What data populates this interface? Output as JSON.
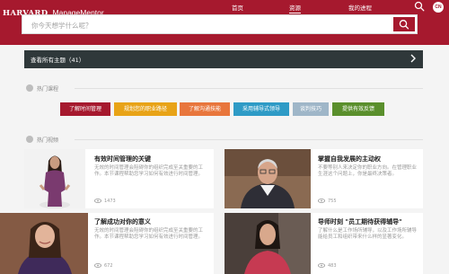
{
  "brand": {
    "harvard": "HARVARD",
    "product": "ManageMentor"
  },
  "nav": {
    "home": "首页",
    "resources": "资源",
    "learning": "我的进程"
  },
  "avatar": {
    "initials": "CN"
  },
  "search": {
    "placeholder": "你今天想学什么呢？"
  },
  "topics_bar": {
    "label": "查看所有主题（41）"
  },
  "hot_courses": {
    "title": "热门课程",
    "tags": [
      {
        "label": "了解时间管理",
        "color": "#a6192e"
      },
      {
        "label": "规划您的职业路径",
        "color": "#e8a317"
      },
      {
        "label": "了解沟通技能",
        "color": "#e8763c"
      },
      {
        "label": "采用辅导式领导",
        "color": "#2e9bc6"
      },
      {
        "label": "谈判技巧",
        "color": "#9fb6c8"
      },
      {
        "label": "提供有效反馈",
        "color": "#5a8f2c"
      }
    ]
  },
  "hot_videos": {
    "title": "热门视频",
    "items": [
      {
        "title": "有效时间管理的关键",
        "desc": "无效的时间管理会阻碍你的组织完成至关重要的工作。本节课程帮助您学习如何有效进行时间管理。",
        "views": "1473"
      },
      {
        "title": "掌握自我发展的主动权",
        "desc": "不要等别人来决定你的职业方向。在管理职业生涯这个问题上，你是最终决策者。",
        "views": "755"
      },
      {
        "title": "了解成功对你的意义",
        "desc": "无效的时间管理会阻碍你的组织完成至关重要的工作。本节课程帮助您学习如何有效进行时间管理。",
        "views": "672"
      },
      {
        "title": "导师时刻 \"员工期待获得辅导\"",
        "desc": "了解什么是工作场所辅导，以及工作场所辅导能给员工和组织带来什么样的显著变化。",
        "views": "483"
      }
    ]
  },
  "colors": {
    "brand_red": "#a6192e",
    "dark_bar": "#2f383a"
  }
}
